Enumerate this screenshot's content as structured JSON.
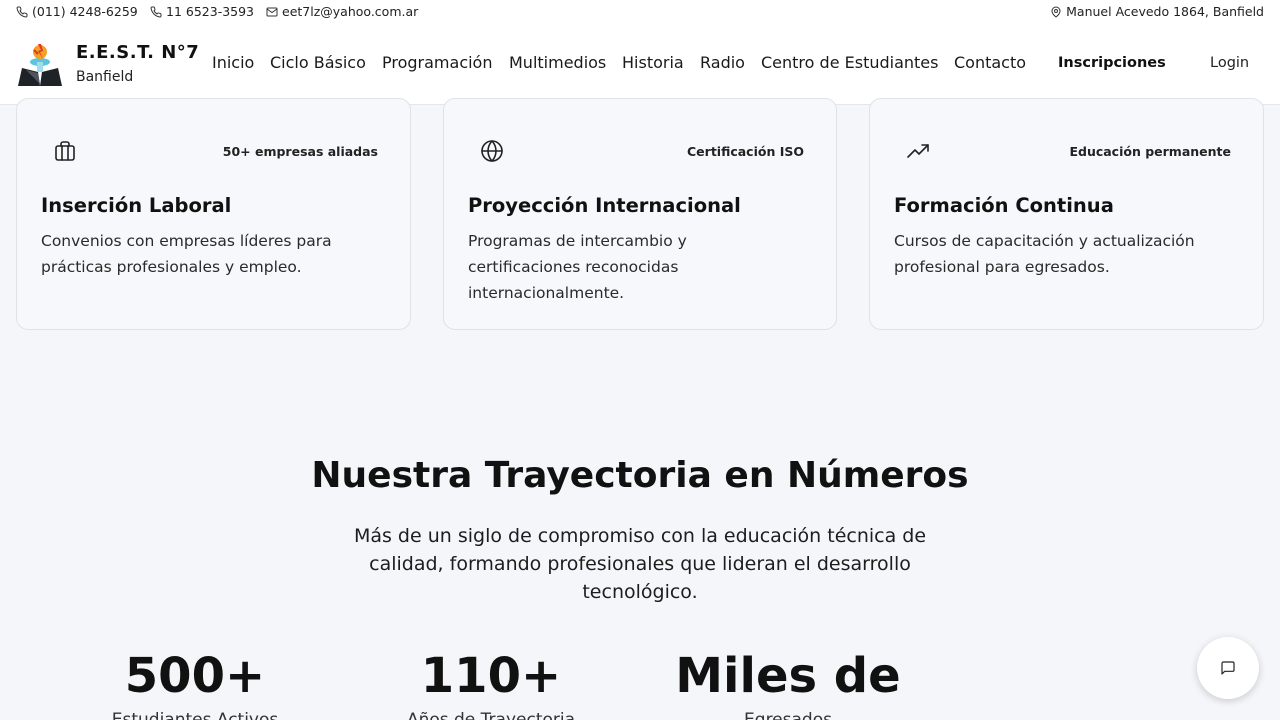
{
  "topbar": {
    "phone1": "(011) 4248-6259",
    "phone2": "11 6523-3593",
    "email": "eet7lz@yahoo.com.ar",
    "address": "Manuel Acevedo 1864, Banfield"
  },
  "brand": {
    "title": "E.E.S.T. N°7",
    "subtitle": "Banfield"
  },
  "nav": {
    "items": [
      "Inicio",
      "Ciclo Básico",
      "Programación",
      "Multimedios",
      "Historia",
      "Radio",
      "Centro de Estudiantes",
      "Contacto"
    ],
    "cta": "Inscripciones",
    "login": "Login"
  },
  "cards": [
    {
      "icon": "briefcase-icon",
      "badge": "50+ empresas aliadas",
      "title": "Inserción Laboral",
      "description": "Convenios con empresas líderes para prácticas profesionales y empleo."
    },
    {
      "icon": "globe-icon",
      "badge": "Certificación ISO",
      "title": "Proyección Internacional",
      "description": "Programas de intercambio y certificaciones reconocidas internacionalmente."
    },
    {
      "icon": "trending-up-icon",
      "badge": "Educación permanente",
      "title": "Formación Continua",
      "description": "Cursos de capacitación y actualización profesional para egresados."
    }
  ],
  "stats": {
    "title": "Nuestra Trayectoria en Números",
    "subtitle": "Más de un siglo de compromiso con la educación técnica de calidad, formando profesionales que lideran el desarrollo tecnológico.",
    "items": [
      {
        "value": "500+",
        "label": "Estudiantes Activos"
      },
      {
        "value": "110+",
        "label": "Años de Trayectoria"
      },
      {
        "value": "Miles de",
        "label": "Egresados"
      }
    ]
  }
}
